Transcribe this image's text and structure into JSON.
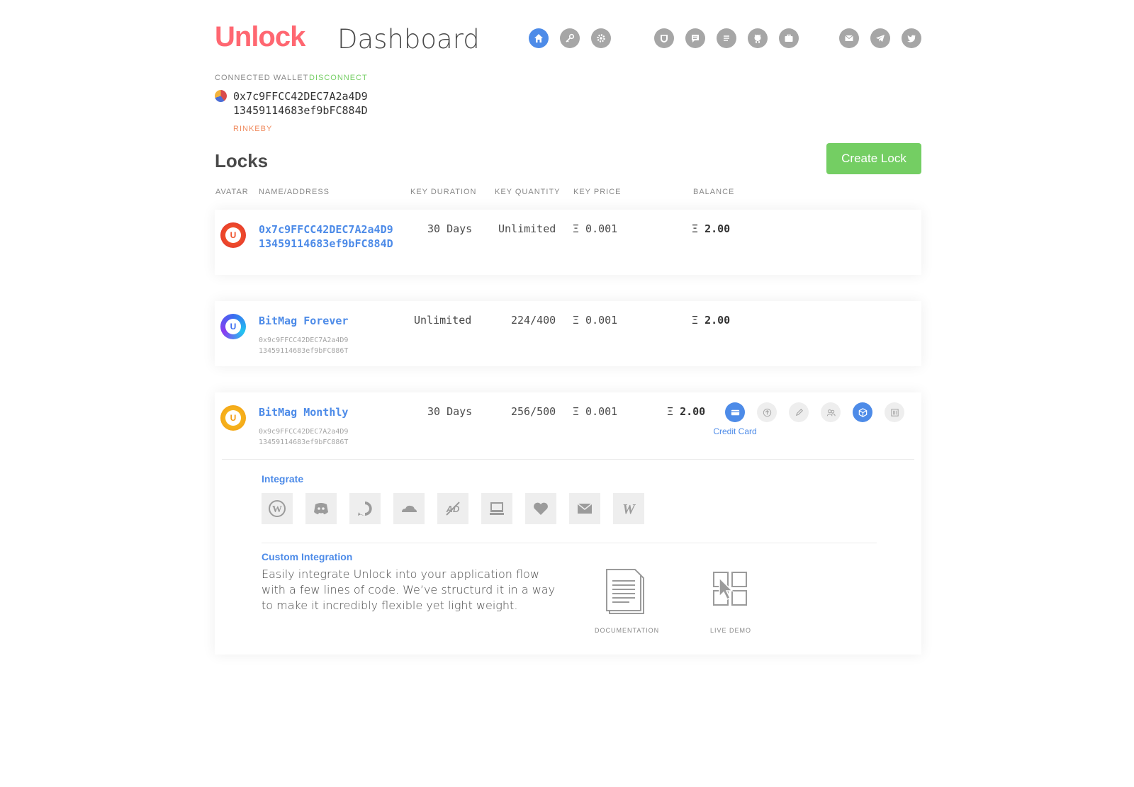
{
  "header": {
    "logo": "Unlock",
    "title": "Dashboard",
    "nav_icons": [
      "home-icon",
      "key-icon",
      "gear-icon",
      "unlock-icon",
      "chat-icon",
      "list-icon",
      "github-icon",
      "briefcase-icon",
      "mail-icon",
      "telegram-icon",
      "twitter-icon"
    ]
  },
  "wallet": {
    "label": "CONNECTED WALLET",
    "disconnect": "DISCONNECT",
    "address_line1": "0x7c9FFCC42DEC7A2a4D9",
    "address_line2": "13459114683ef9bFC884D",
    "network": "RINKEBY"
  },
  "locks": {
    "heading": "Locks",
    "create_button": "Create Lock",
    "columns": [
      "AVATAR",
      "NAME/ADDRESS",
      "KEY DURATION",
      "KEY QUANTITY",
      "KEY PRICE",
      "BALANCE"
    ],
    "rows": [
      {
        "name_line1": "0x7c9FFCC42DEC7A2a4D9",
        "name_line2": "13459114683ef9bFC884D",
        "duration": "30 Days",
        "quantity": "Unlimited",
        "price": "Ξ 0.001",
        "balance_symbol": "Ξ",
        "balance": "2.00",
        "avatar_color": "#f0502a"
      },
      {
        "name": "BitMag Forever",
        "address_line1": "0x9c9FFCC42DEC7A2a4D9",
        "address_line2": "13459114683ef9bFC886T",
        "duration": "Unlimited",
        "quantity": "224/400",
        "price": "Ξ 0.001",
        "balance_symbol": "Ξ",
        "balance": "2.00",
        "avatar_color": "#3b6cf0"
      },
      {
        "name": "BitMag Monthly",
        "address_line1": "0x9c9FFCC42DEC7A2a4D9",
        "address_line2": "13459114683ef9bFC886T",
        "duration": "30 Days",
        "quantity": "256/500",
        "price": "Ξ 0.001",
        "balance_symbol": "Ξ",
        "balance": "2.00",
        "avatar_color": "#f6b51e",
        "active_action_label": "Credit Card"
      }
    ]
  },
  "integrate": {
    "title": "Integrate",
    "tiles": [
      "wordpress-icon",
      "discord-icon",
      "discourse-icon",
      "cloudflare-icon",
      "adblock-icon",
      "computer-icon",
      "heart-icon",
      "mail-icon",
      "wix-icon"
    ],
    "custom_title": "Custom Integration",
    "custom_text": "Easily integrate Unlock into your application flow with a few lines of code. We’ve structurd it in a way to make it incredibly flexible yet light weight.",
    "documentation_label": "DOCUMENTATION",
    "live_demo_label": "LIVE DEMO"
  },
  "colors": {
    "brand": "#ff6771",
    "accent": "#4d8be8",
    "success": "#74ce63"
  }
}
